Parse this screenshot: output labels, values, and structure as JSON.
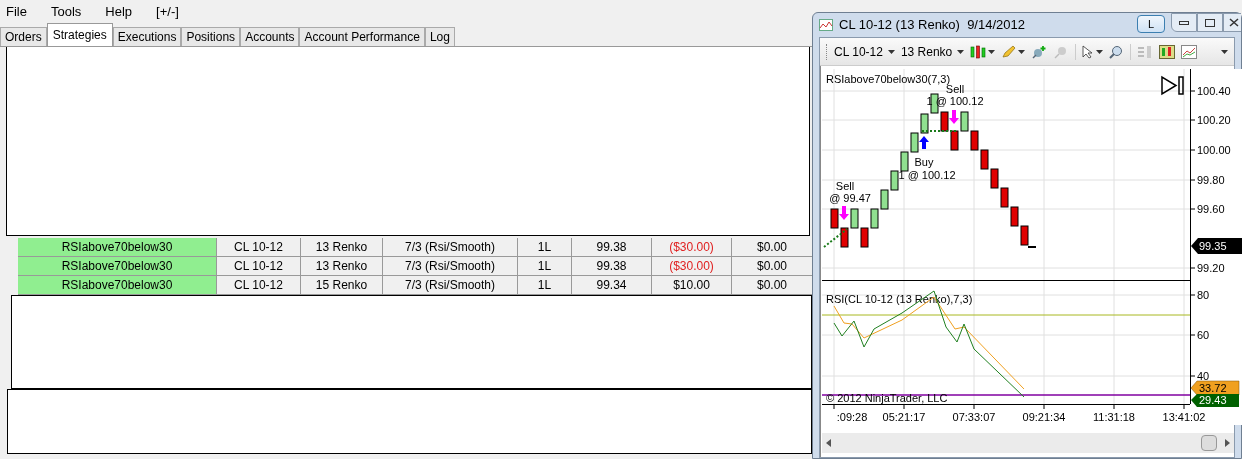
{
  "menu": [
    "File",
    "Tools",
    "Help",
    "[+/-]"
  ],
  "tabs": [
    {
      "label": "Orders",
      "selected": false
    },
    {
      "label": "Strategies",
      "selected": true
    },
    {
      "label": "Executions",
      "selected": false
    },
    {
      "label": "Positions",
      "selected": false
    },
    {
      "label": "Accounts",
      "selected": false
    },
    {
      "label": "Account Performance",
      "selected": false
    },
    {
      "label": "Log",
      "selected": false
    }
  ],
  "strategy_rows": [
    {
      "strategy": "RSIabove70below30",
      "instrument": "CL 10-12",
      "period": "13 Renko",
      "parameters": "7/3 (Rsi/Smooth)",
      "position": "1L",
      "avg_price": "99.38",
      "unrealized": {
        "text": "($30.00)",
        "negative": true
      },
      "realized": "$0.00"
    },
    {
      "strategy": "RSIabove70below30",
      "instrument": "CL 10-12",
      "period": "13 Renko",
      "parameters": "7/3 (Rsi/Smooth)",
      "position": "1L",
      "avg_price": "99.38",
      "unrealized": {
        "text": "($30.00)",
        "negative": true
      },
      "realized": "$0.00"
    },
    {
      "strategy": "RSIabove70below30",
      "instrument": "CL 10-12",
      "period": "15 Renko",
      "parameters": "7/3 (Rsi/Smooth)",
      "position": "1L",
      "avg_price": "99.34",
      "unrealized": {
        "text": "$10.00",
        "negative": false
      },
      "realized": "$0.00"
    }
  ],
  "chart_window": {
    "title": "CL 10-12 (13 Renko)  9/14/2012",
    "link_button": "L",
    "toolbar": {
      "instrument": "CL 10-12",
      "period": "13 Renko"
    },
    "price_panel": {
      "label": "RSIabove70below30(7,3)",
      "y_labels": [
        "100.40",
        "100.20",
        "100.00",
        "99.80",
        "99.60",
        "99.20"
      ],
      "last_price": "99.35",
      "annotations": [
        {
          "kind": "sell",
          "title": "Sell",
          "detail": "@ 99.47"
        },
        {
          "kind": "sell",
          "title": "Sell",
          "detail": "1 @ 100.12"
        },
        {
          "kind": "buy",
          "title": "Buy",
          "detail": "1 @ 100.12"
        }
      ]
    },
    "rsi_panel": {
      "label": "RSI(CL 10-12 (13 Renko),7,3)",
      "y_labels": [
        "80",
        "60",
        "40"
      ],
      "rsi_value": "29.43",
      "smooth_value": "33.72",
      "copyright": "© 2012 NinjaTrader, LLC"
    },
    "time_labels": [
      ":09:28",
      "05:21:17",
      "07:33:07",
      "09:21:34",
      "11:31:18",
      "13:41:02"
    ]
  }
}
